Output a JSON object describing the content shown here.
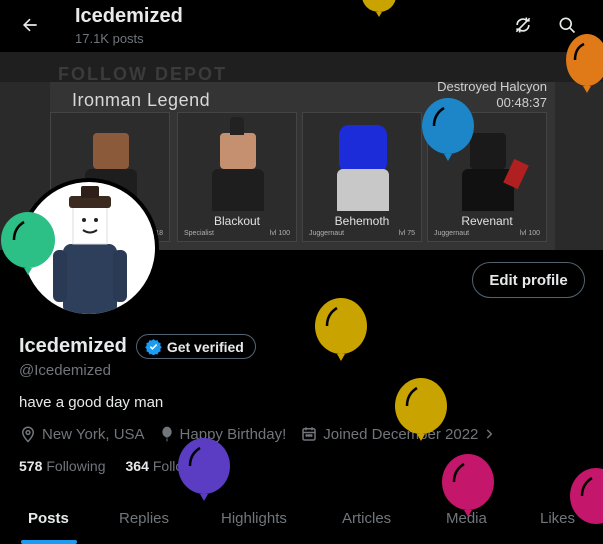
{
  "header": {
    "title": "Icedemized",
    "subtitle": "17.1K posts",
    "back_icon": "arrow-left-icon",
    "refresh_icon": "no-sync-icon",
    "search_icon": "search-icon"
  },
  "banner": {
    "faint_text": "FOLLOW DEPOT",
    "title": "Ironman Legend",
    "right_line1": "Destroyed Halcyon",
    "right_line2": "00:48:37",
    "cards": [
      {
        "name": "",
        "role": "",
        "level": "lvl 18"
      },
      {
        "name": "Blackout",
        "role": "Specialist",
        "level": "lvl 100"
      },
      {
        "name": "Behemoth",
        "role": "Juggernaut",
        "level": "lvl 75"
      },
      {
        "name": "Revenant",
        "role": "Juggernaut",
        "level": "lvl 100"
      }
    ]
  },
  "profile": {
    "edit_label": "Edit profile",
    "display_name": "Icedemized",
    "verify_label": "Get verified",
    "handle": "@Icedemized",
    "bio": "have a good day man",
    "location": "New York, USA",
    "birthday": "Happy Birthday!",
    "joined": "Joined December 2022",
    "following_count": "578",
    "following_label": "Following",
    "followers_count": "364",
    "followers_label": "Followers"
  },
  "tabs": [
    "Posts",
    "Replies",
    "Highlights",
    "Articles",
    "Media",
    "Likes"
  ],
  "colors": {
    "accent": "#1d9bf0",
    "balloon_gold": "#c9a400",
    "balloon_blue": "#1c86c9",
    "balloon_orange": "#e07a18",
    "balloon_green": "#2cbf86",
    "balloon_purple": "#5b3dc4",
    "balloon_magenta": "#c4166b"
  }
}
